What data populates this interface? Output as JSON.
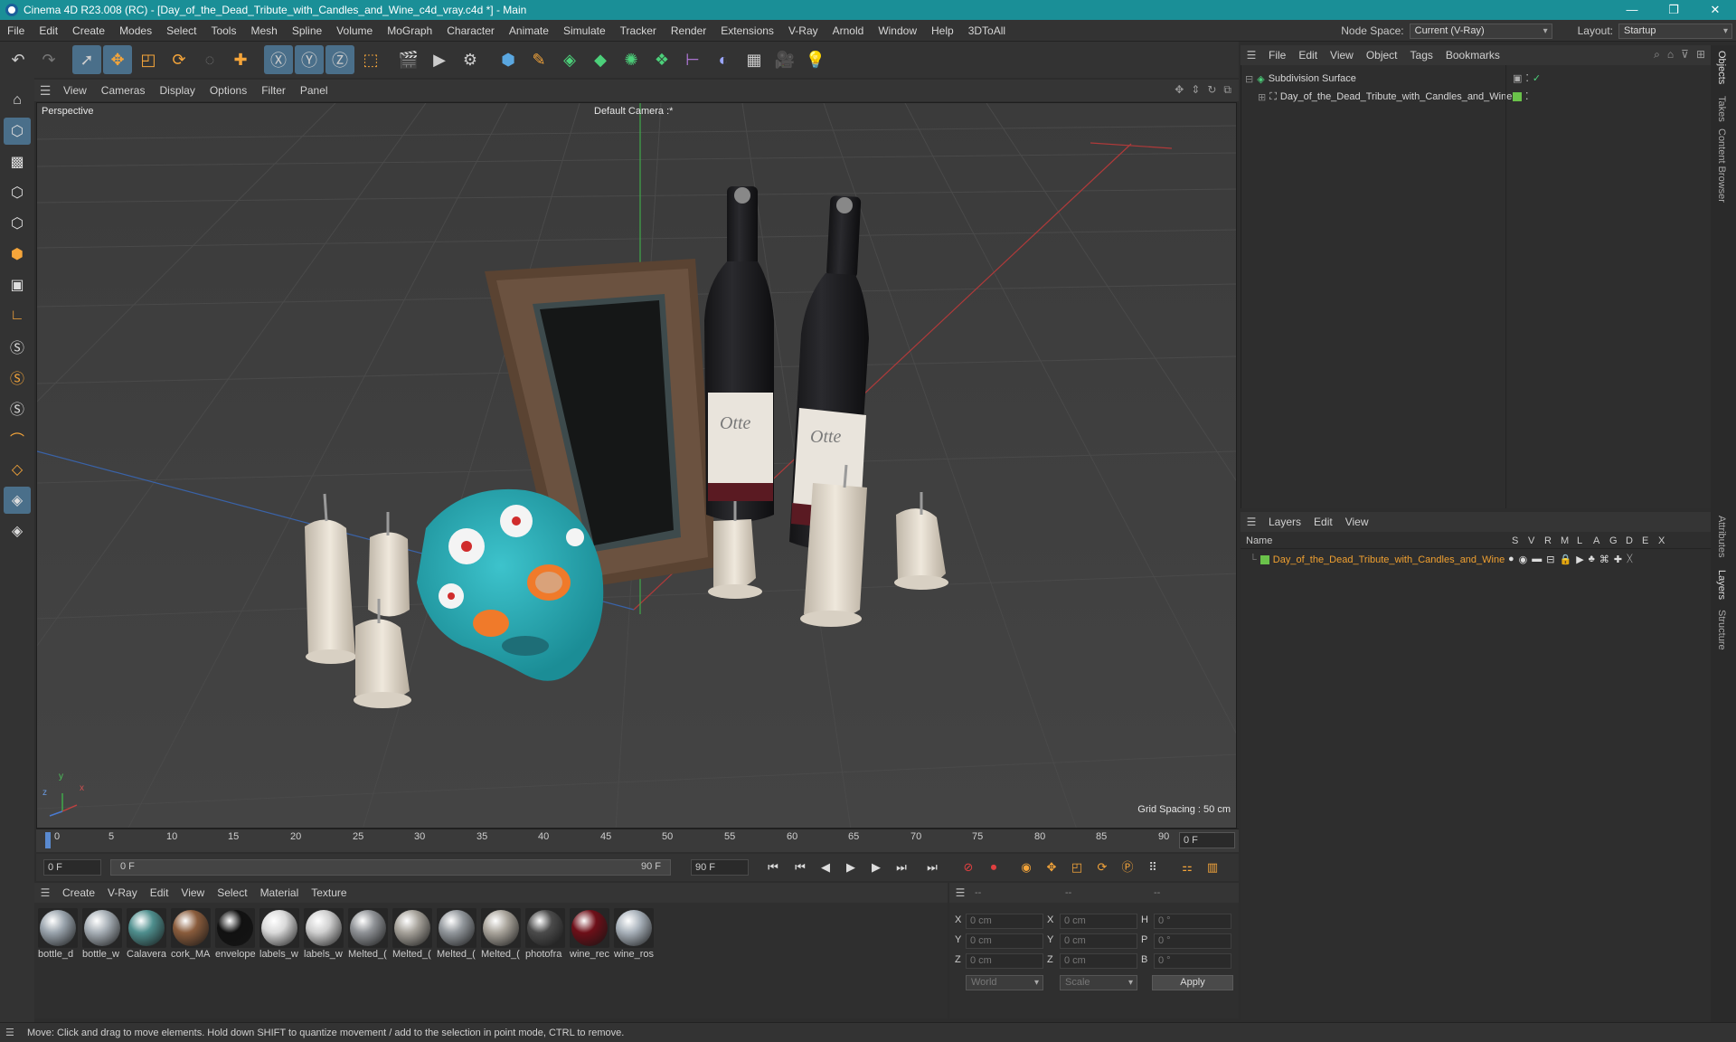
{
  "window": {
    "title": "Cinema 4D R23.008 (RC) - [Day_of_the_Dead_Tribute_with_Candles_and_Wine_c4d_vray.c4d *] - Main",
    "minimize": "—",
    "maximize": "❐",
    "close": "✕"
  },
  "menubar": {
    "items": [
      "File",
      "Edit",
      "Create",
      "Modes",
      "Select",
      "Tools",
      "Mesh",
      "Spline",
      "Volume",
      "MoGraph",
      "Character",
      "Animate",
      "Simulate",
      "Tracker",
      "Render",
      "Extensions",
      "V-Ray",
      "Arnold",
      "Window",
      "Help",
      "3DToAll"
    ],
    "node_space_label": "Node Space:",
    "node_space_value": "Current (V-Ray)",
    "layout_label": "Layout:",
    "layout_value": "Startup"
  },
  "viewport": {
    "menu": [
      "View",
      "Cameras",
      "Display",
      "Options",
      "Filter",
      "Panel"
    ],
    "view_name": "Perspective",
    "camera": "Default Camera :*",
    "grid_spacing": "Grid Spacing : 50 cm",
    "axis_y": "y",
    "axis_x": "x",
    "axis_z": "z",
    "label_text_1": "Otte",
    "label_text_2": "Otte"
  },
  "timeline": {
    "ticks": [
      "0",
      "5",
      "10",
      "15",
      "20",
      "25",
      "30",
      "35",
      "40",
      "45",
      "50",
      "55",
      "60",
      "65",
      "70",
      "75",
      "80",
      "85",
      "90"
    ],
    "current_frame": "0 F"
  },
  "transport": {
    "start": "0 F",
    "range_start": "0 F",
    "range_end": "90 F",
    "end": "90 F"
  },
  "materials": {
    "menu": [
      "Create",
      "V-Ray",
      "Edit",
      "View",
      "Select",
      "Material",
      "Texture"
    ],
    "items": [
      {
        "name": "bottle_d",
        "color": "#9aa4ad"
      },
      {
        "name": "bottle_w",
        "color": "#a7afb6"
      },
      {
        "name": "Calavera",
        "color": "#4f8f8e"
      },
      {
        "name": "cork_MA",
        "color": "#8a5c3c"
      },
      {
        "name": "envelope",
        "color": "#111111"
      },
      {
        "name": "labels_w",
        "color": "#d9d9d9"
      },
      {
        "name": "labels_w",
        "color": "#cfcfcf"
      },
      {
        "name": "Melted_(",
        "color": "#8f9296"
      },
      {
        "name": "Melted_(",
        "color": "#a6a29a"
      },
      {
        "name": "Melted_(",
        "color": "#92979c"
      },
      {
        "name": "Melted_(",
        "color": "#aaa59c"
      },
      {
        "name": "photofra",
        "color": "#4b4b4b"
      },
      {
        "name": "wine_rec",
        "color": "#6e0f18"
      },
      {
        "name": "wine_ros",
        "color": "#a9b2bb"
      }
    ]
  },
  "coordinates": {
    "head": [
      "--",
      "--",
      "--"
    ],
    "rows": [
      {
        "a": "X",
        "av": "0 cm",
        "b": "X",
        "bv": "0 cm",
        "c": "H",
        "cv": "0 °"
      },
      {
        "a": "Y",
        "av": "0 cm",
        "b": "Y",
        "bv": "0 cm",
        "c": "P",
        "cv": "0 °"
      },
      {
        "a": "Z",
        "av": "0 cm",
        "b": "Z",
        "bv": "0 cm",
        "c": "B",
        "cv": "0 °"
      }
    ],
    "world": "World",
    "scale": "Scale",
    "apply": "Apply"
  },
  "objects": {
    "menu": [
      "File",
      "Edit",
      "View",
      "Object",
      "Tags",
      "Bookmarks"
    ],
    "items": [
      {
        "name": "Subdivision Surface"
      },
      {
        "name": "Day_of_the_Dead_Tribute_with_Candles_and_Wine"
      }
    ]
  },
  "layers": {
    "menu": [
      "Layers",
      "Edit",
      "View"
    ],
    "name_header": "Name",
    "cols": [
      "S",
      "V",
      "R",
      "M",
      "L",
      "A",
      "G",
      "D",
      "E",
      "X"
    ],
    "item": "Day_of_the_Dead_Tribute_with_Candles_and_Wine"
  },
  "sidetabs": [
    "Objects",
    "Takes",
    "Content Browser",
    "Attributes",
    "Layers",
    "Structure"
  ],
  "status": "Move: Click and drag to move elements. Hold down SHIFT to quantize movement / add to the selection in point mode, CTRL to remove.",
  "colors": {
    "titlebar": "#1a8f97",
    "accent_select": "#4a6f8a",
    "layer_name": "#f0a030"
  }
}
